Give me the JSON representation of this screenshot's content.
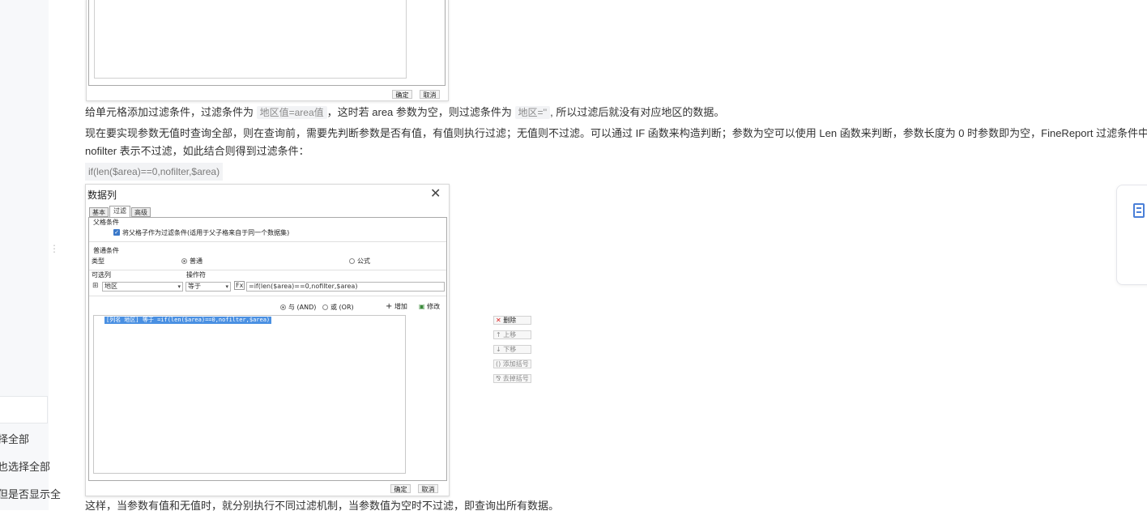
{
  "sidebar": {
    "items": [
      {
        "label": "择全部"
      },
      {
        "label": "也选择全部"
      },
      {
        "label": "但是否显示全"
      }
    ]
  },
  "top_dialog": {
    "ok": "确定",
    "cancel": "取消"
  },
  "article": {
    "p1_pre": "给单元格添加过滤条件，过滤条件为 ",
    "p1_code1": "地区值=area值",
    "p1_mid": "，这时若 area 参数为空，则过滤条件为 ",
    "p1_code2": "地区=''",
    "p1_post": ", 所以过滤后就没有对应地区的数据。",
    "p2_line1": "现在要实现参数无值时查询全部，则在查询前，需要先判断参数是否有值，有值则执行过滤；无值则不过滤。可以通过 IF 函数来构造判断；参数为空可以使用 Len 函数来判断，参数长度为 0 时参数即为空，FineReport 过滤条件中，",
    "p2_line2": "nofilter 表示不过滤，如此结合则得到过滤条件：",
    "code": "if(len($area)==0,nofilter,$area)",
    "p3": "这样，当参数有值和无值时，就分别执行不同过滤机制，当参数值为空时不过滤，即查询出所有数据。"
  },
  "data_dialog": {
    "title": "数据列",
    "tabs": [
      "基本",
      "过滤",
      "高级"
    ],
    "parent_section": "父格条件",
    "parent_checkbox": "将父格子作为过滤条件(适用于父子格来自于同一个数据集)",
    "normal_section": "普通条件",
    "type_label": "类型",
    "radio_normal": "普通",
    "radio_formula": "公式",
    "col_label": "可选列",
    "op_label": "操作符",
    "col_value": "地区",
    "op_value": "等于",
    "formula_value": "=if(len($area)==0,nofilter,$area)",
    "and_label": "与 (AND)",
    "or_label": "或 (OR)",
    "add_label": "增加",
    "modify_label": "修改",
    "condition_item": "[列名 地区] 等于  =if(len($area)==0,nofilter,$area)",
    "delete_label": "删除",
    "up_label": "上移",
    "down_label": "下移",
    "add_bracket": "添加括号",
    "remove_bracket": "去掉括号",
    "ok": "确定",
    "cancel": "取消"
  },
  "colors": {
    "selection": "#4a90e2",
    "checkbox": "#3a78c9"
  }
}
